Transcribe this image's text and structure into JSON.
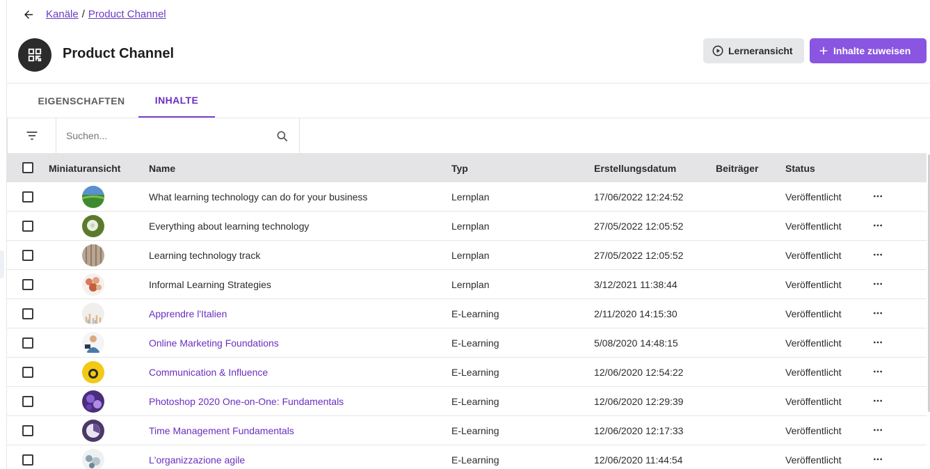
{
  "breadcrumb": {
    "parent": "Kanäle",
    "separator": "/",
    "current": "Product Channel"
  },
  "channel": {
    "title": "Product Channel"
  },
  "actions": {
    "learner_view": "Lerneransicht",
    "assign_content": "Inhalte zuweisen"
  },
  "tabs": [
    {
      "label": "EIGENSCHAFTEN",
      "active": false
    },
    {
      "label": "INHALTE",
      "active": true
    }
  ],
  "search": {
    "placeholder": "Suchen..."
  },
  "table": {
    "headers": {
      "thumbnail": "Miniaturansicht",
      "name": "Name",
      "type": "Typ",
      "created": "Erstellungsdatum",
      "contributors": "Beiträger",
      "status": "Status"
    },
    "rows": [
      {
        "name": "What learning technology can do for your business",
        "type": "Lernplan",
        "created": "17/06/2022 12:24:52",
        "contributors": "",
        "status": "Veröffentlicht",
        "link": false,
        "thumb": "meadow"
      },
      {
        "name": "Everything about learning technology",
        "type": "Lernplan",
        "created": "27/05/2022 12:05:52",
        "contributors": "",
        "status": "Veröffentlicht",
        "link": false,
        "thumb": "dandelion"
      },
      {
        "name": "Learning technology track",
        "type": "Lernplan",
        "created": "27/05/2022 12:05:52",
        "contributors": "",
        "status": "Veröffentlicht",
        "link": false,
        "thumb": "wood"
      },
      {
        "name": "Informal Learning Strategies",
        "type": "Lernplan",
        "created": "3/12/2021 11:38:44",
        "contributors": "",
        "status": "Veröffentlicht",
        "link": false,
        "thumb": "hands"
      },
      {
        "name": "Apprendre l'Italien",
        "type": "E-Learning",
        "created": "2/11/2020 14:15:30",
        "contributors": "",
        "status": "Veröffentlicht",
        "link": true,
        "thumb": "pastel"
      },
      {
        "name": "Online Marketing Foundations",
        "type": "E-Learning",
        "created": "5/08/2020 14:48:15",
        "contributors": "",
        "status": "Veröffentlicht",
        "link": true,
        "thumb": "person"
      },
      {
        "name": "Communication & Influence",
        "type": "E-Learning",
        "created": "12/06/2020 12:54:22",
        "contributors": "",
        "status": "Veröffentlicht",
        "link": true,
        "thumb": "yellow"
      },
      {
        "name": "Photoshop 2020 One-on-One: Fundamentals",
        "type": "E-Learning",
        "created": "12/06/2020 12:29:39",
        "contributors": "",
        "status": "Veröffentlicht",
        "link": true,
        "thumb": "purple"
      },
      {
        "name": "Time Management Fundamentals",
        "type": "E-Learning",
        "created": "12/06/2020 12:17:33",
        "contributors": "",
        "status": "Veröffentlicht",
        "link": true,
        "thumb": "clock"
      },
      {
        "name": "L'organizzazione agile",
        "type": "E-Learning",
        "created": "12/06/2020 11:44:54",
        "contributors": "",
        "status": "Veröffentlicht",
        "link": true,
        "thumb": "stones"
      }
    ]
  },
  "colors": {
    "accent": "#8a55e0",
    "link": "#6a2fc0",
    "header_bg": "#e4e4e6"
  }
}
